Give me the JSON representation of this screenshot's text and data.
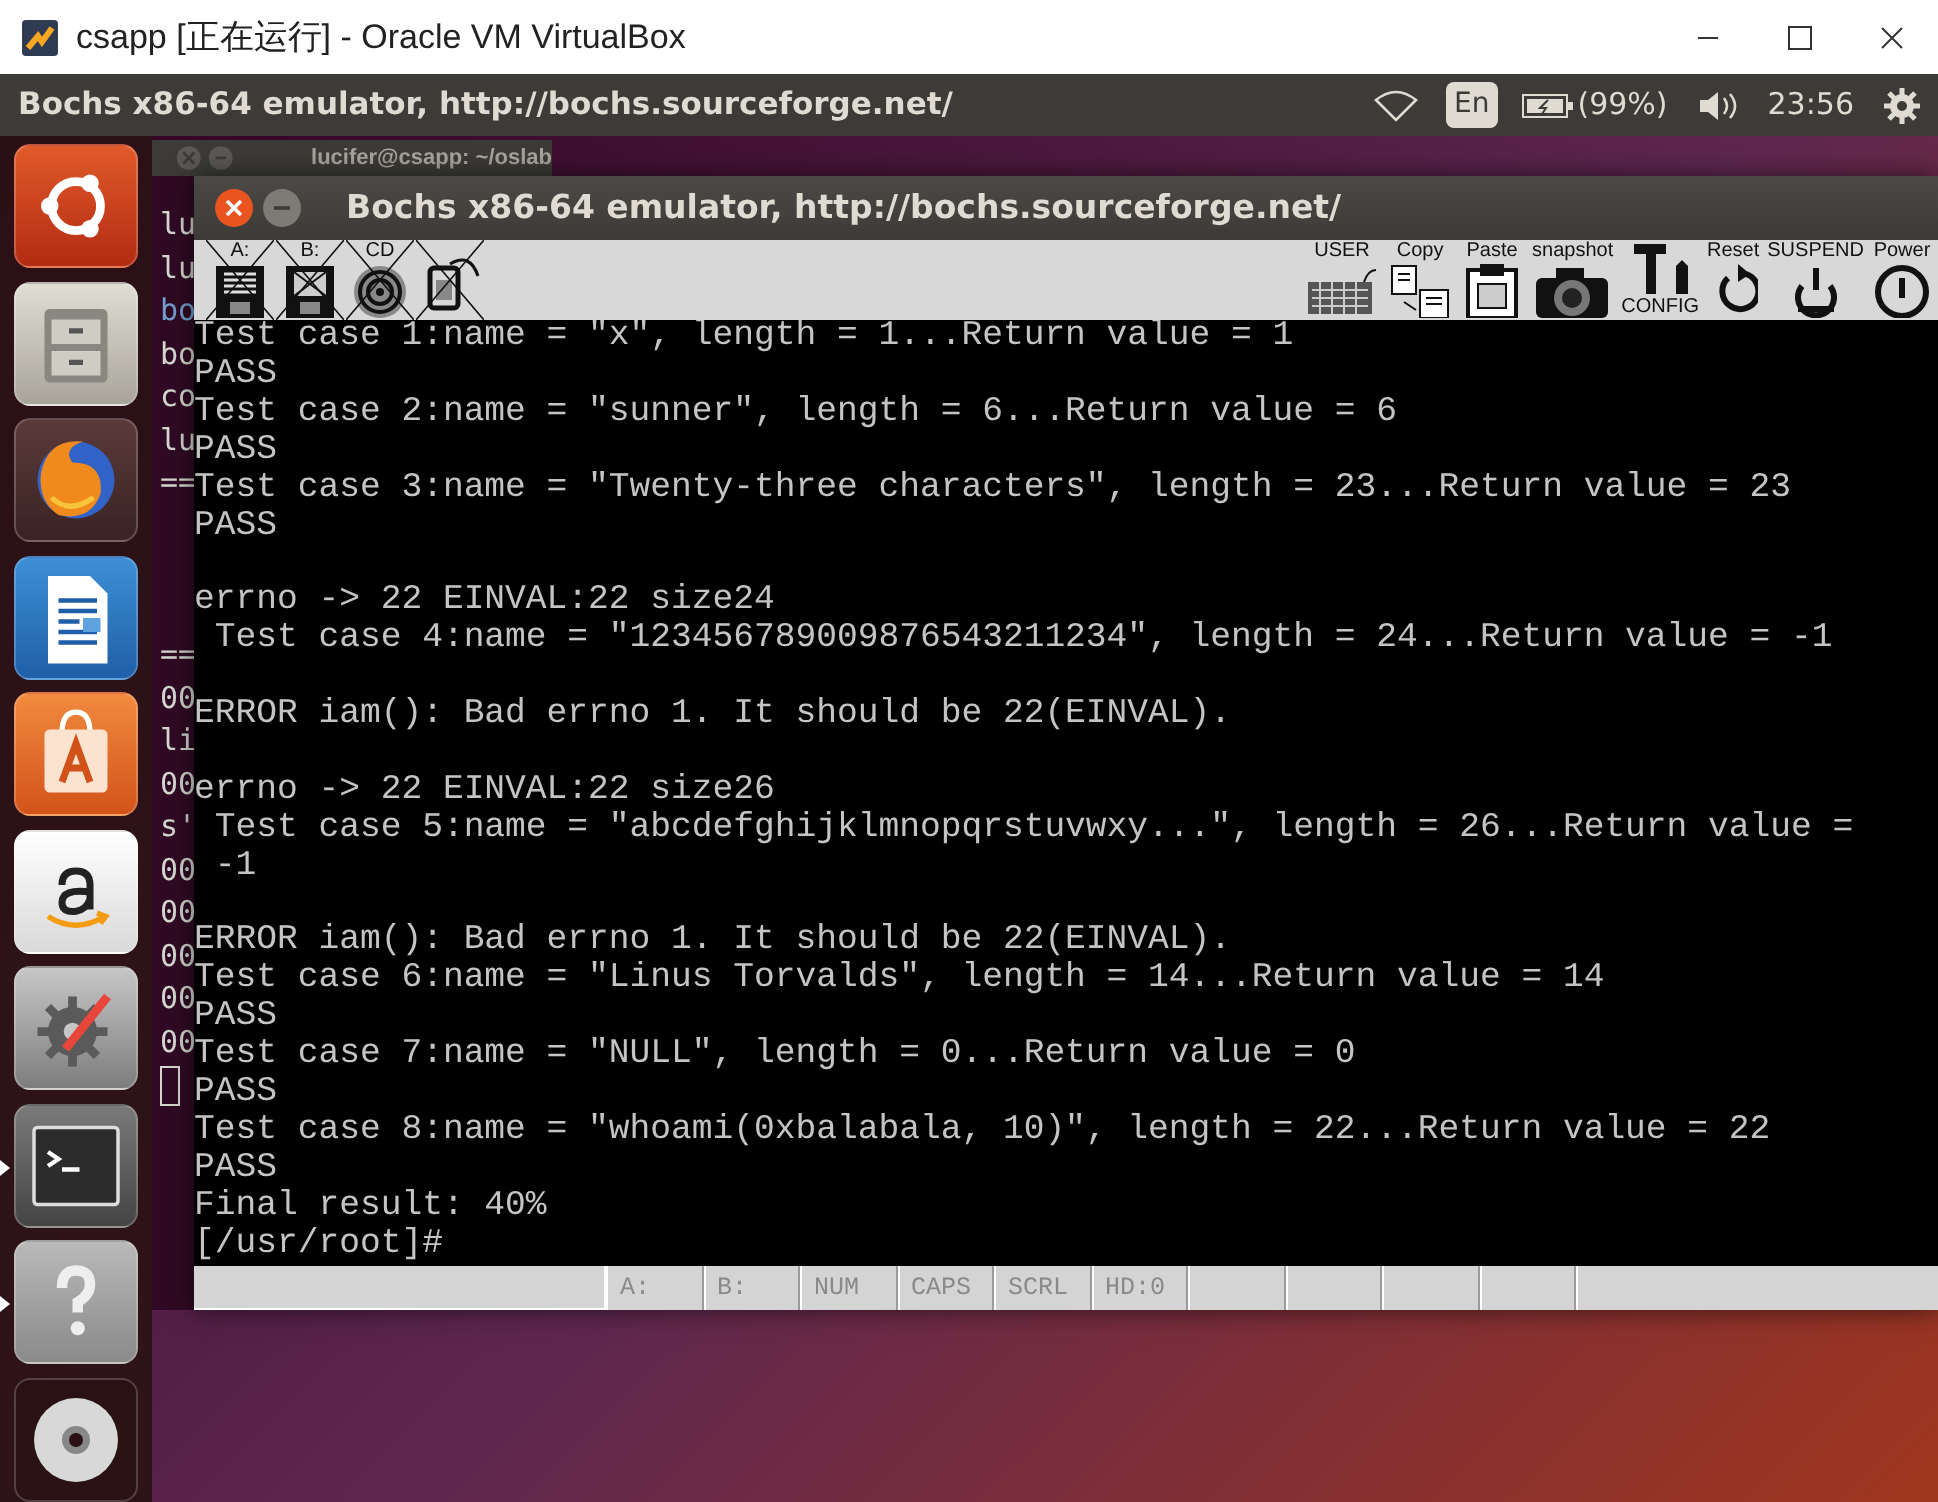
{
  "vm_window": {
    "title": "csapp [正在运行] - Oracle VM VirtualBox"
  },
  "top_panel": {
    "title": "Bochs x86-64 emulator, http://bochs.sourceforge.net/",
    "keyboard": "En",
    "battery": "(99%)",
    "clock": "23:56"
  },
  "launcher": {
    "items": [
      {
        "kind": "ubuntu",
        "running": false
      },
      {
        "kind": "files",
        "running": false
      },
      {
        "kind": "firefox",
        "running": false
      },
      {
        "kind": "writer",
        "running": false
      },
      {
        "kind": "store",
        "running": false
      },
      {
        "kind": "amazon",
        "running": false
      },
      {
        "kind": "settings",
        "running": false
      },
      {
        "kind": "terminal",
        "running": true
      },
      {
        "kind": "help",
        "running": true
      },
      {
        "kind": "disc",
        "running": false
      }
    ]
  },
  "background_terminal": {
    "title": "lucifer@csapp: ~/oslab",
    "lines": [
      {
        "text": "lu",
        "color": "#d3d7cf"
      },
      {
        "text": "lu",
        "color": "#d3d7cf"
      },
      {
        "text": "bo",
        "color": "#729fcf"
      },
      {
        "text": "bo",
        "color": "#d3d7cf"
      },
      {
        "text": "co",
        "color": "#d3d7cf"
      },
      {
        "text": "lu",
        "color": "#d3d7cf"
      },
      {
        "text": "==",
        "color": "#d3d7cf"
      },
      {
        "kind": "blank"
      },
      {
        "kind": "blank"
      },
      {
        "kind": "blank"
      },
      {
        "text": "==",
        "color": "#d3d7cf"
      },
      {
        "text": "00",
        "color": "#d3d7cf"
      },
      {
        "text": "li",
        "color": "#d3d7cf"
      },
      {
        "text": "00",
        "color": "#d3d7cf"
      },
      {
        "text": "s'",
        "color": "#d3d7cf"
      },
      {
        "text": "00",
        "color": "#d3d7cf"
      },
      {
        "text": "00",
        "color": "#d3d7cf"
      },
      {
        "text": "00",
        "color": "#d3d7cf"
      },
      {
        "text": "00",
        "color": "#d3d7cf"
      },
      {
        "text": "00",
        "color": "#d3d7cf"
      }
    ]
  },
  "bochs_window": {
    "title": "Bochs x86-64 emulator, http://bochs.sourceforge.net/",
    "toolbar": {
      "left": [
        {
          "kind": "floppy",
          "label": "A:"
        },
        {
          "kind": "floppy2",
          "label": "B:"
        },
        {
          "kind": "cdrom",
          "label": "CD"
        },
        {
          "kind": "usb"
        }
      ],
      "right": [
        {
          "kind": "user",
          "label": "USER"
        },
        {
          "kind": "copy",
          "label": "Copy"
        },
        {
          "kind": "paste",
          "label": "Paste"
        },
        {
          "kind": "snapshot",
          "label": "snapshot"
        },
        {
          "kind": "config",
          "label": "CONFIG"
        },
        {
          "kind": "reset",
          "label": "Reset"
        },
        {
          "kind": "suspend",
          "label": "SUSPEND"
        },
        {
          "kind": "power",
          "label": "Power"
        }
      ]
    },
    "screen_lines": [
      {
        "text": "Test case 1:name = \"x\", length = 1...Return value = 1"
      },
      {
        "text": "PASS"
      },
      {
        "text": "Test case 2:name = \"sunner\", length = 6...Return value = 6"
      },
      {
        "text": "PASS"
      },
      {
        "text": "Test case 3:name = \"Twenty-three characters\", length = 23...Return value = 23"
      },
      {
        "text": "PASS"
      },
      {
        "kind": "blank"
      },
      {
        "text": "errno -> 22 EINVAL:22 size24"
      },
      {
        "text": " Test case 4:name = \"123456789009876543211234\", length = 24...Return value = -1"
      },
      {
        "kind": "blank"
      },
      {
        "text": "ERROR iam(): Bad errno 1. It should be 22(EINVAL)."
      },
      {
        "kind": "blank"
      },
      {
        "text": "errno -> 22 EINVAL:22 size26"
      },
      {
        "text": " Test case 5:name = \"abcdefghijklmnopqrstuvwxy...\", length = 26...Return value ="
      },
      {
        "text": " -1"
      },
      {
        "kind": "blank"
      },
      {
        "text": "ERROR iam(): Bad errno 1. It should be 22(EINVAL)."
      },
      {
        "text": "Test case 6:name = \"Linus Torvalds\", length = 14...Return value = 14"
      },
      {
        "text": "PASS"
      },
      {
        "text": "Test case 7:name = \"NULL\", length = 0...Return value = 0"
      },
      {
        "text": "PASS"
      },
      {
        "text": "Test case 8:name = \"whoami(0xbalabala, 10)\", length = 22...Return value = 22"
      },
      {
        "text": "PASS"
      },
      {
        "text": "Final result: 40%"
      },
      {
        "text": "[/usr/root]#"
      }
    ],
    "status_bar": [
      "A:",
      "B:",
      "NUM",
      "CAPS",
      "SCRL",
      "HD:0"
    ]
  }
}
